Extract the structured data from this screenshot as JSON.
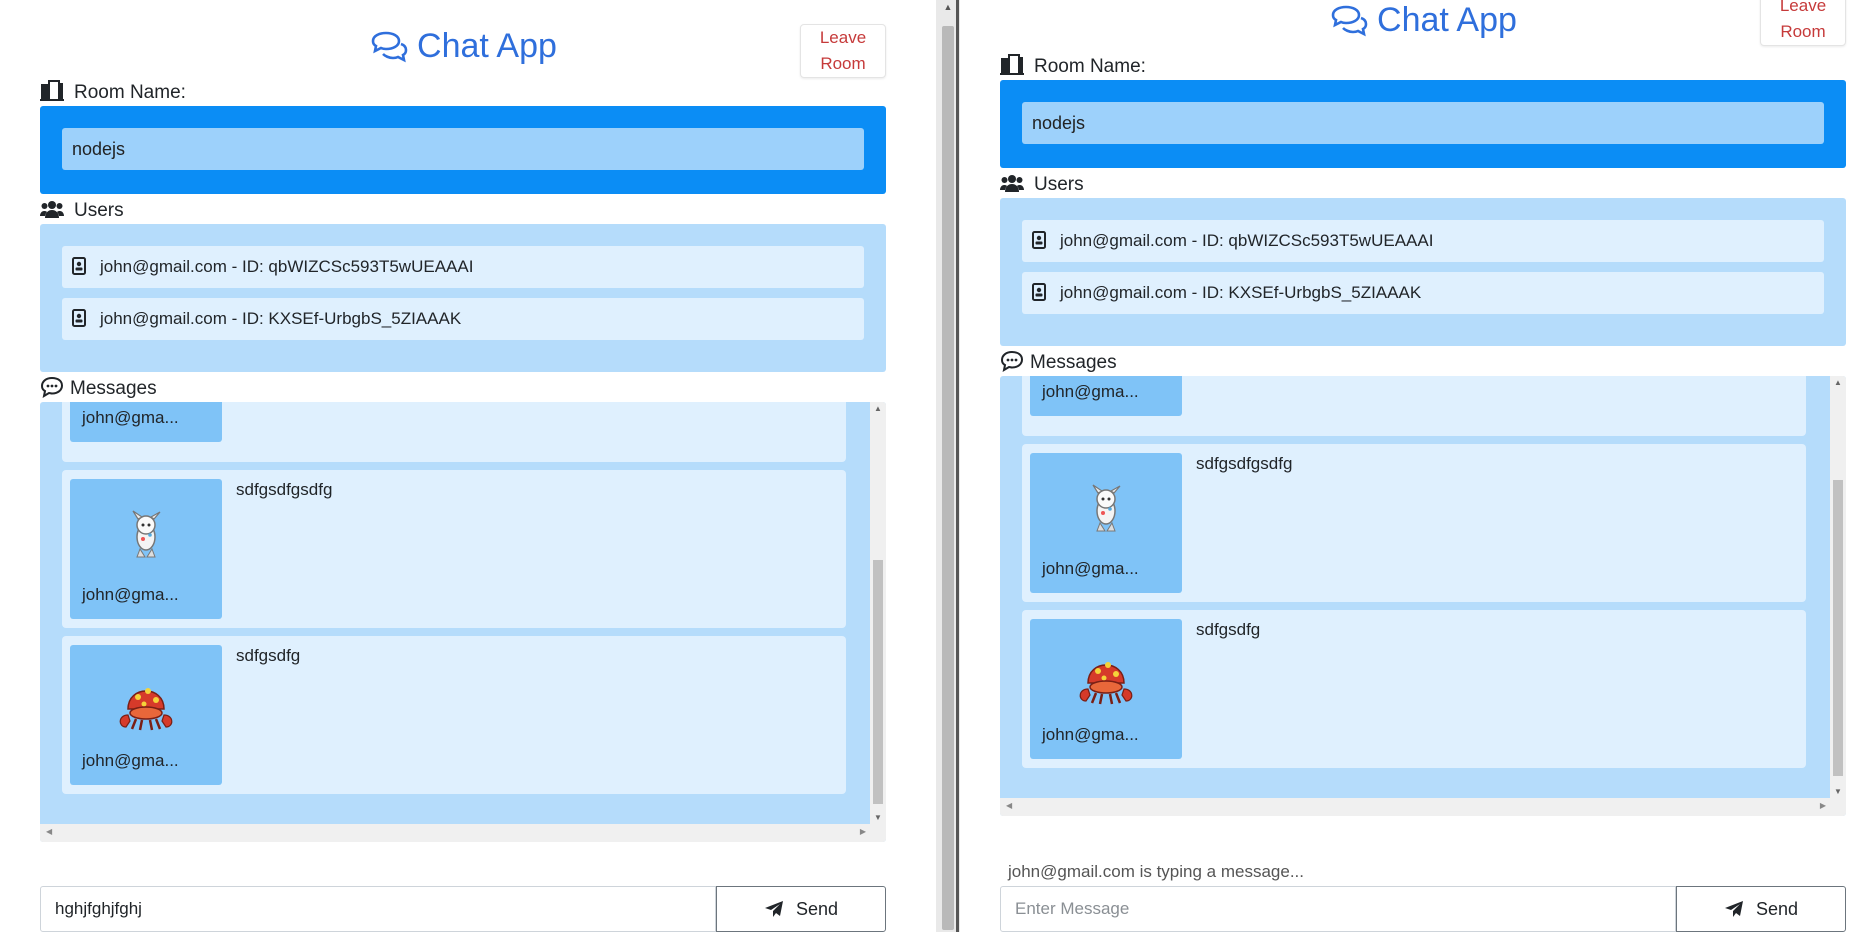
{
  "app": {
    "title": "Chat App",
    "leave_button": [
      "Leave",
      "Room"
    ],
    "room_label": "Room Name:",
    "room_name": "nodejs",
    "users_label": "Users",
    "messages_label": "Messages",
    "send_label": "Send"
  },
  "users": [
    {
      "text": "john@gmail.com - ID: qbWIZCSc593T5wUEAAAI"
    },
    {
      "text": "john@gmail.com - ID: KXSEf-UrbgbS_5ZIAAAK"
    }
  ],
  "messages": [
    {
      "user": "john@gma...",
      "text": "",
      "avatar": "none"
    },
    {
      "user": "john@gma...",
      "text": "sdfgsdfgsdfg",
      "avatar": "white-sprite-icon"
    },
    {
      "user": "john@gma...",
      "text": "sdfgsdfg",
      "avatar": "red-crab-sprite-icon"
    }
  ],
  "left_window": {
    "composer_value": "hghjfghjfghj",
    "scroll_position": 0.75
  },
  "right_window": {
    "typing_indicator": "john@gmail.com is typing a message...",
    "composer_placeholder": "Enter Message",
    "scroll_position": 0.75
  },
  "colors": {
    "brand": "#2f6fdc",
    "room_bg": "#0b8df5",
    "panel_bg": "#b5dcfb",
    "row_bg": "#dff0fe",
    "avatar_bg": "#7fc3f7",
    "leave_text": "#c63a3a"
  }
}
